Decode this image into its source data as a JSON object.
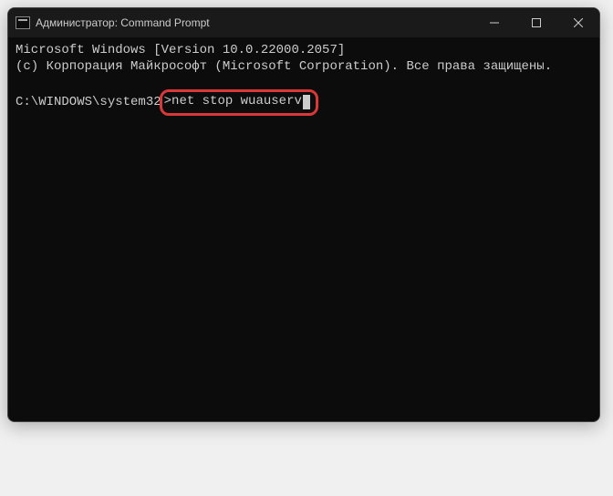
{
  "titlebar": {
    "title": "Администратор: Command Prompt"
  },
  "terminal": {
    "line1": "Microsoft Windows [Version 10.0.22000.2057]",
    "line2": "(c) Корпорация Майкрософт (Microsoft Corporation). Все права защищены.",
    "prompt_path": "C:\\WINDOWS\\system32",
    "prompt_symbol": ">",
    "command": "net stop wuauserv"
  }
}
